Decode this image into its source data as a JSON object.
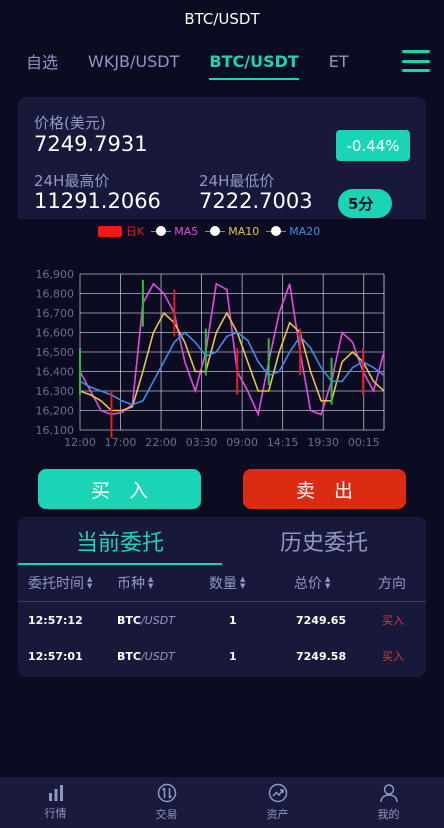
{
  "window_title": "BTC/USDT",
  "tabs": [
    {
      "label": "自选"
    },
    {
      "label": "WKJB/USDT"
    },
    {
      "label": "BTC/USDT"
    },
    {
      "label": "ET"
    }
  ],
  "price_card": {
    "price_label": "价格(美元)",
    "price": "7249.7931",
    "change": "-0.44%",
    "high_label": "24H最高价",
    "high": "11291.2066",
    "low_label": "24H最低价",
    "low": "7222.7003",
    "interval": "5分"
  },
  "legend": {
    "kline": "日K",
    "ma5": "MA5",
    "ma10": "MA10",
    "ma20": "MA20",
    "colors": {
      "kline": "#f01818",
      "ma5": "#e44ae0",
      "ma10": "#e8c14a",
      "ma20": "#3d8ee6"
    }
  },
  "chart_data": {
    "type": "line",
    "title": "",
    "y_ticks": [
      "16,900",
      "16,800",
      "16,700",
      "16,600",
      "16,500",
      "16,400",
      "16,300",
      "16,200",
      "16,100"
    ],
    "x_ticks": [
      "12:00",
      "17:00",
      "22:00",
      "03:30",
      "09:00",
      "14:15",
      "19:30",
      "00:15"
    ],
    "ylim": [
      16100,
      16900
    ],
    "grid": true,
    "series": [
      {
        "name": "MA5",
        "color": "#e44ae0",
        "values": [
          16400,
          16300,
          16200,
          16180,
          16190,
          16230,
          16750,
          16850,
          16800,
          16700,
          16450,
          16300,
          16500,
          16850,
          16820,
          16400,
          16300,
          16180,
          16450,
          16700,
          16850,
          16500,
          16200,
          16180,
          16350,
          16600,
          16550,
          16400,
          16300,
          16500
        ]
      },
      {
        "name": "MA10",
        "color": "#e8c14a",
        "values": [
          16300,
          16280,
          16250,
          16200,
          16200,
          16220,
          16400,
          16600,
          16700,
          16650,
          16550,
          16400,
          16400,
          16600,
          16700,
          16600,
          16450,
          16300,
          16300,
          16500,
          16650,
          16600,
          16400,
          16250,
          16250,
          16450,
          16500,
          16450,
          16350,
          16300
        ]
      },
      {
        "name": "MA20",
        "color": "#3d8ee6",
        "values": [
          16350,
          16320,
          16300,
          16280,
          16250,
          16230,
          16250,
          16350,
          16450,
          16550,
          16600,
          16550,
          16480,
          16500,
          16580,
          16600,
          16560,
          16450,
          16380,
          16400,
          16500,
          16580,
          16520,
          16420,
          16350,
          16350,
          16420,
          16450,
          16420,
          16380
        ]
      }
    ]
  },
  "actions": {
    "buy": "买　入",
    "sell": "卖　出"
  },
  "orders": {
    "tabs": [
      "当前委托",
      "历史委托"
    ],
    "columns": [
      "委托时间",
      "币种",
      "数量",
      "总价",
      "方向"
    ],
    "rows": [
      {
        "time": "12:57:12",
        "coin": "BTC",
        "unit": "/USDT",
        "qty": "1",
        "total": "7249.65",
        "dir": "买入"
      },
      {
        "time": "12:57:01",
        "coin": "BTC",
        "unit": "/USDT",
        "qty": "1",
        "total": "7249.58",
        "dir": "买入"
      }
    ]
  },
  "bottom_nav": [
    {
      "label": "行情",
      "icon": "chart-bars-icon"
    },
    {
      "label": "交易",
      "icon": "swap-icon"
    },
    {
      "label": "资产",
      "icon": "trend-icon"
    },
    {
      "label": "我的",
      "icon": "user-icon"
    }
  ]
}
